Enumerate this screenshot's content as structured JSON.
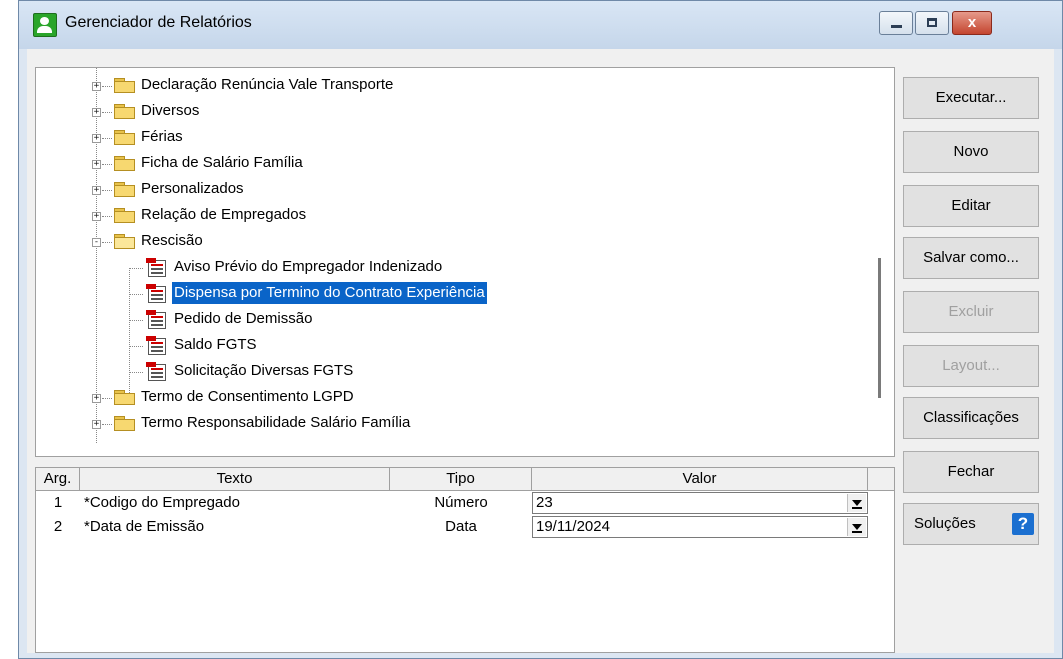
{
  "window": {
    "title": "Gerenciador de Relatórios",
    "close_glyph": "x"
  },
  "tree": {
    "folders_top": [
      {
        "label": "Declaração Renúncia Vale Transporte"
      },
      {
        "label": "Diversos"
      },
      {
        "label": "Férias"
      },
      {
        "label": "Ficha de Salário Família"
      },
      {
        "label": "Personalizados"
      },
      {
        "label": "Relação de Empregados"
      }
    ],
    "open_folder": {
      "label": "Rescisão"
    },
    "reports": [
      {
        "label": "Aviso Prévio do Empregador Indenizado"
      },
      {
        "label": "Dispensa por Termino do Contrato Experiência"
      },
      {
        "label": "Pedido de Demissão"
      },
      {
        "label": "Saldo FGTS"
      },
      {
        "label": "Solicitação Diversas FGTS"
      }
    ],
    "folders_bottom": [
      {
        "label": "Termo de Consentimento LGPD"
      },
      {
        "label": "Termo Responsabilidade Salário Família"
      }
    ],
    "expand_glyph": "+",
    "collapse_glyph": "-"
  },
  "grid": {
    "headers": [
      "Arg.",
      "Texto",
      "Tipo",
      "Valor"
    ],
    "rows": [
      {
        "arg": "1",
        "texto": "*Codigo do Empregado",
        "tipo": "Número",
        "valor": "23"
      },
      {
        "arg": "2",
        "texto": "*Data de Emissão",
        "tipo": "Data",
        "valor": "19/11/2024"
      }
    ]
  },
  "buttons": {
    "executar": "Executar...",
    "novo": "Novo",
    "editar": "Editar",
    "salvar_como": "Salvar como...",
    "excluir": "Excluir",
    "layout": "Layout...",
    "classificacoes": "Classificações",
    "fechar": "Fechar",
    "solucoes": "Soluções",
    "help_glyph": "?"
  },
  "colors": {
    "selection": "#0a64c8",
    "accent": "#1b6fd0"
  }
}
